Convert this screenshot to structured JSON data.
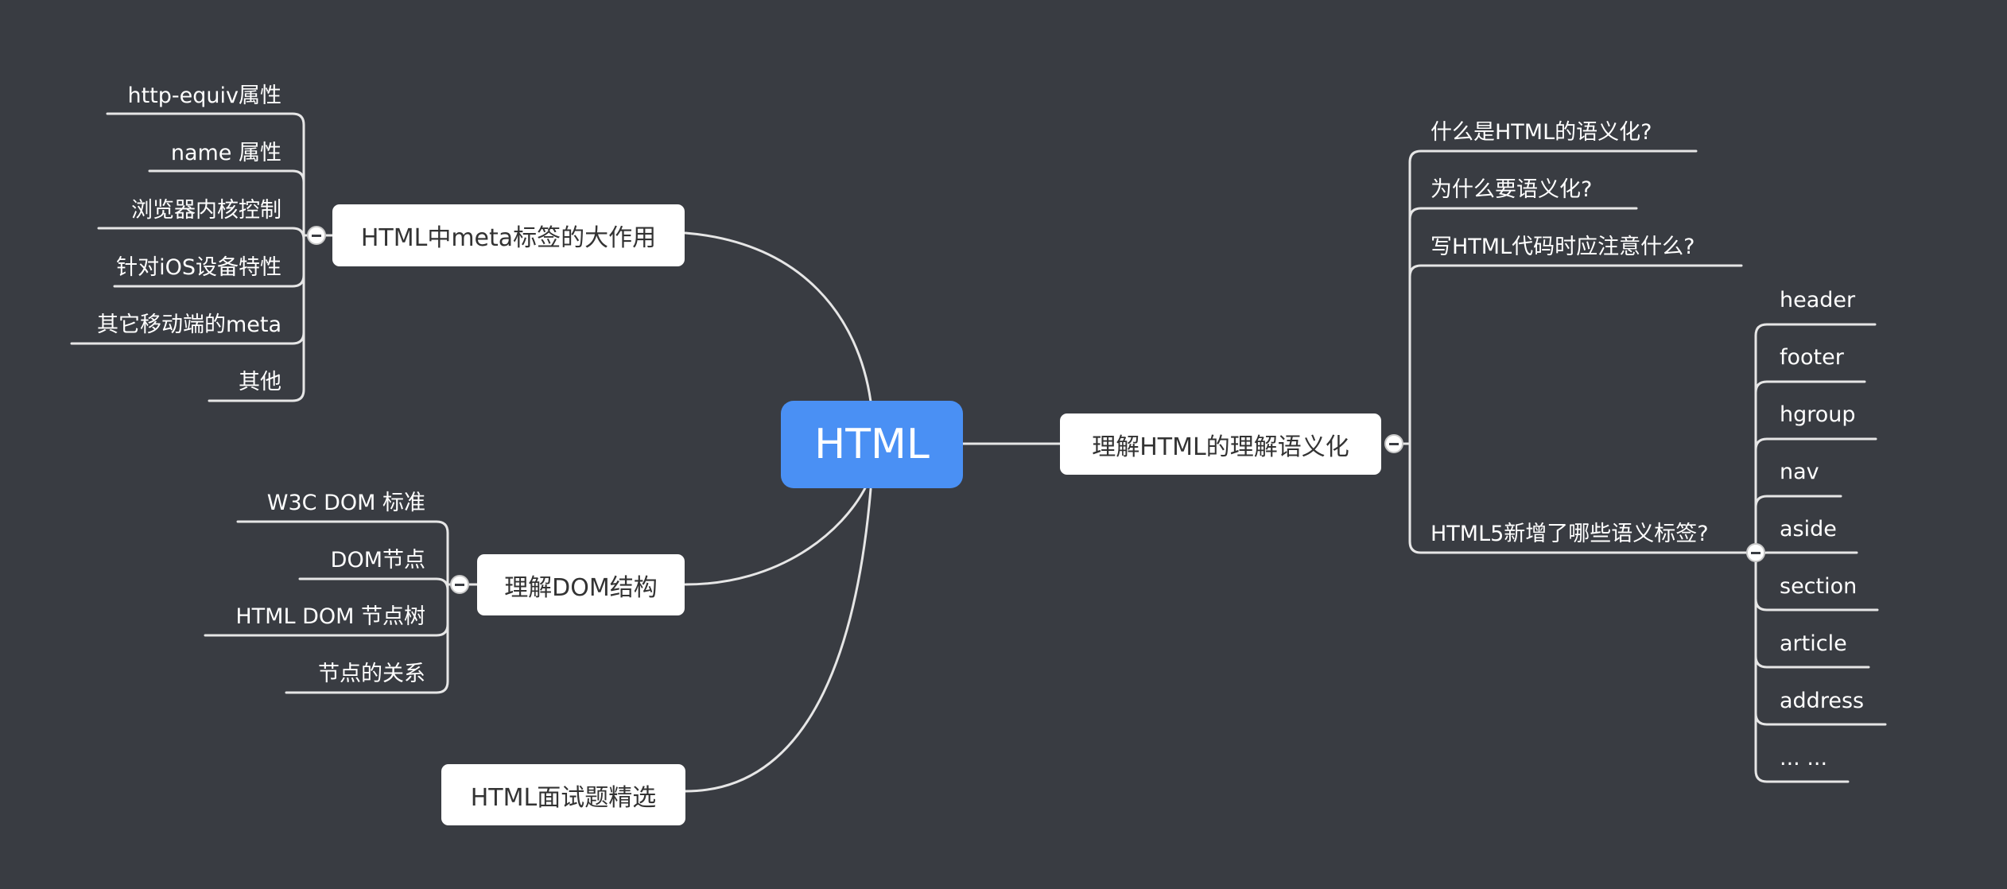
{
  "root": "HTML",
  "topics": {
    "meta": {
      "label": "HTML中meta标签的大作用",
      "children": [
        "http-equiv属性",
        "name 属性",
        "浏览器内核控制",
        "针对iOS设备特性",
        "其它移动端的meta",
        "其他"
      ]
    },
    "dom": {
      "label": "理解DOM结构",
      "children": [
        "W3C DOM 标准",
        "DOM节点",
        "HTML DOM 节点树",
        "节点的关系"
      ]
    },
    "interview": {
      "label": "HTML面试题精选"
    },
    "semantic": {
      "label": "理解HTML的理解语义化",
      "children": [
        "什么是HTML的语义化?",
        "为什么要语义化?",
        "写HTML代码时应注意什么?",
        "HTML5新增了哪些语义标签?"
      ],
      "html5_tags": [
        "header",
        "footer",
        "hgroup",
        "nav",
        "aside",
        "section",
        "article",
        "address",
        "... ..."
      ]
    }
  },
  "colors": {
    "background": "#393c42",
    "root_fill": "#4a90f4",
    "topic_fill": "#ffffff",
    "connector": "#e6e6e6"
  }
}
